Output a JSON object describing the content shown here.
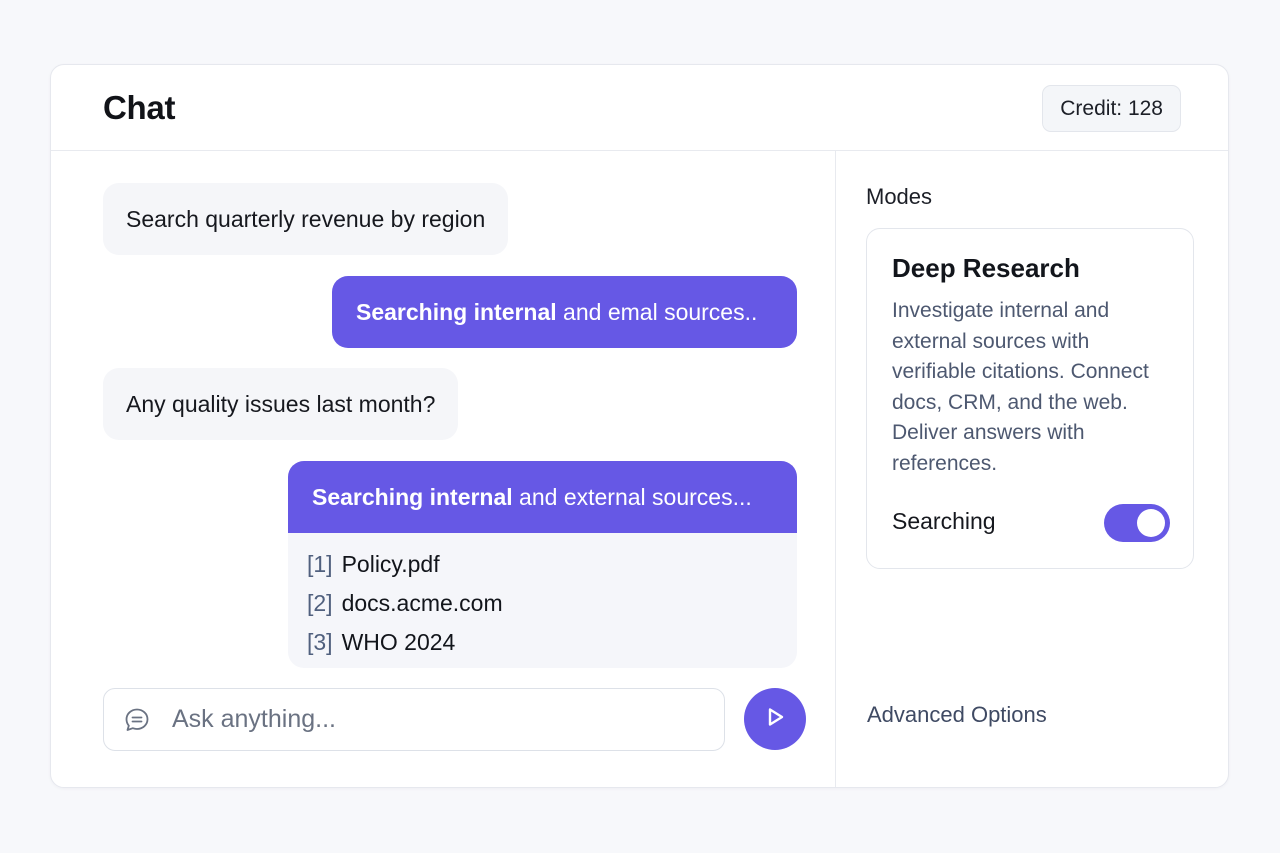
{
  "header": {
    "title": "Chat",
    "credit": "Credit: 128"
  },
  "messages": [
    {
      "role": "user",
      "text": "Search quarterly revenue by region"
    },
    {
      "role": "assistant",
      "bold": "Searching internal",
      "rest": " and emal sources.."
    },
    {
      "role": "user",
      "text": "Any quality issues last month?"
    },
    {
      "role": "assistant",
      "bold": "Searching internal",
      "rest": " and external sources..."
    }
  ],
  "citations": [
    {
      "num": "[1]",
      "name": "Policy.pdf"
    },
    {
      "num": "[2]",
      "name": "docs.acme.com"
    },
    {
      "num": "[3]",
      "name": "WHO 2024"
    }
  ],
  "composer": {
    "placeholder": "Ask anything...",
    "value": ""
  },
  "sidebar": {
    "modes_label": "Modes",
    "mode": {
      "title": "Deep Research",
      "description": "Investigate internal and external sources with verifiable citations. Connect docs, CRM, and the web. Deliver answers with references.",
      "toggle_label": "Searching",
      "toggle_on": true
    },
    "advanced_label": "Advanced Options"
  },
  "colors": {
    "accent": "#6658e5",
    "background": "#f7f8fb",
    "user_bubble": "#f5f6f9"
  },
  "icons": {
    "composer": "chat-bubble-icon",
    "send": "play-arrow-icon"
  }
}
